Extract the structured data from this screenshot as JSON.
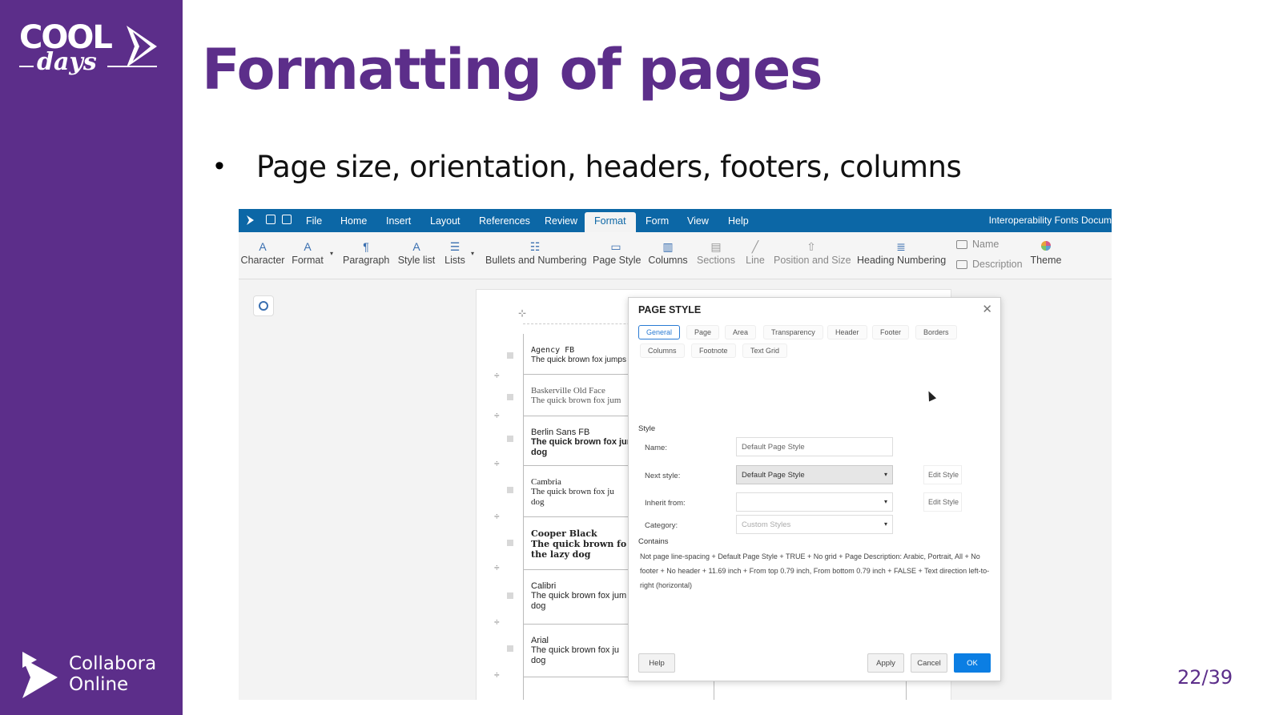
{
  "slide": {
    "title": "Formatting of pages",
    "bullet": "Page size, orientation, headers, footers, columns",
    "page_number": "22/39",
    "logo_top_word": "COOL",
    "logo_bottom_word": "days",
    "brand_line1": "Collabora",
    "brand_line2": "Online"
  },
  "colors": {
    "brand_purple": "#5c2e8a",
    "menubar_blue": "#0c67a6",
    "ok_button_blue": "#0b7ee3"
  },
  "app": {
    "menu": [
      "File",
      "Home",
      "Insert",
      "Layout",
      "References",
      "Review",
      "Format",
      "Form",
      "View",
      "Help"
    ],
    "active_menu": "Format",
    "document_title": "Interoperability Fonts Docum",
    "toolbar": {
      "character": "Character",
      "format": "Format",
      "paragraph": "Paragraph",
      "style_list": "Style list",
      "lists": "Lists",
      "bullets_numbering": "Bullets and Numbering",
      "page_style": "Page Style",
      "columns": "Columns",
      "sections": "Sections",
      "line": "Line",
      "position_size": "Position and Size",
      "heading_numbering": "Heading Numbering",
      "name": "Name",
      "description": "Description",
      "theme": "Theme"
    },
    "fonts": [
      {
        "name": "Agency FB",
        "sample": "The quick brown fox jumps over"
      },
      {
        "name": "Baskerville Old Face",
        "sample": "The quick brown fox jum"
      },
      {
        "name": "Berlin Sans FB",
        "sample": "The quick brown fox jum",
        "sample2": "dog"
      },
      {
        "name": "Cambria",
        "sample": "The quick brown fox ju",
        "sample2": "dog"
      },
      {
        "name": "Cooper Black",
        "sample": "The quick brown fo",
        "sample2": "the lazy dog"
      },
      {
        "name": "Calibri",
        "sample": "The quick brown fox jum",
        "sample2": "dog"
      },
      {
        "name": "Arial",
        "sample": "The quick brown fox ju",
        "sample2": "dog"
      }
    ]
  },
  "dialog": {
    "title": "PAGE STYLE",
    "tabs": [
      "General",
      "Page",
      "Area",
      "Transparency",
      "Header",
      "Footer",
      "Borders",
      "Columns",
      "Footnote",
      "Text Grid"
    ],
    "active_tab": "General",
    "style_section": "Style",
    "name_label": "Name:",
    "name_value": "Default Page Style",
    "next_style_label": "Next style:",
    "next_style_value": "Default Page Style",
    "inherit_label": "Inherit from:",
    "inherit_value": "",
    "category_label": "Category:",
    "category_value": "Custom Styles",
    "edit_style": "Edit Style",
    "contains_label": "Contains",
    "contains_text": "Not page line-spacing + Default Page Style + TRUE + No grid + Page Description: Arabic, Portrait, All + No footer + No header + 11.69 inch + From top 0.79 inch, From bottom 0.79 inch + FALSE + Text direction left-to-right (horizontal)",
    "help": "Help",
    "apply": "Apply",
    "cancel": "Cancel",
    "ok": "OK"
  }
}
